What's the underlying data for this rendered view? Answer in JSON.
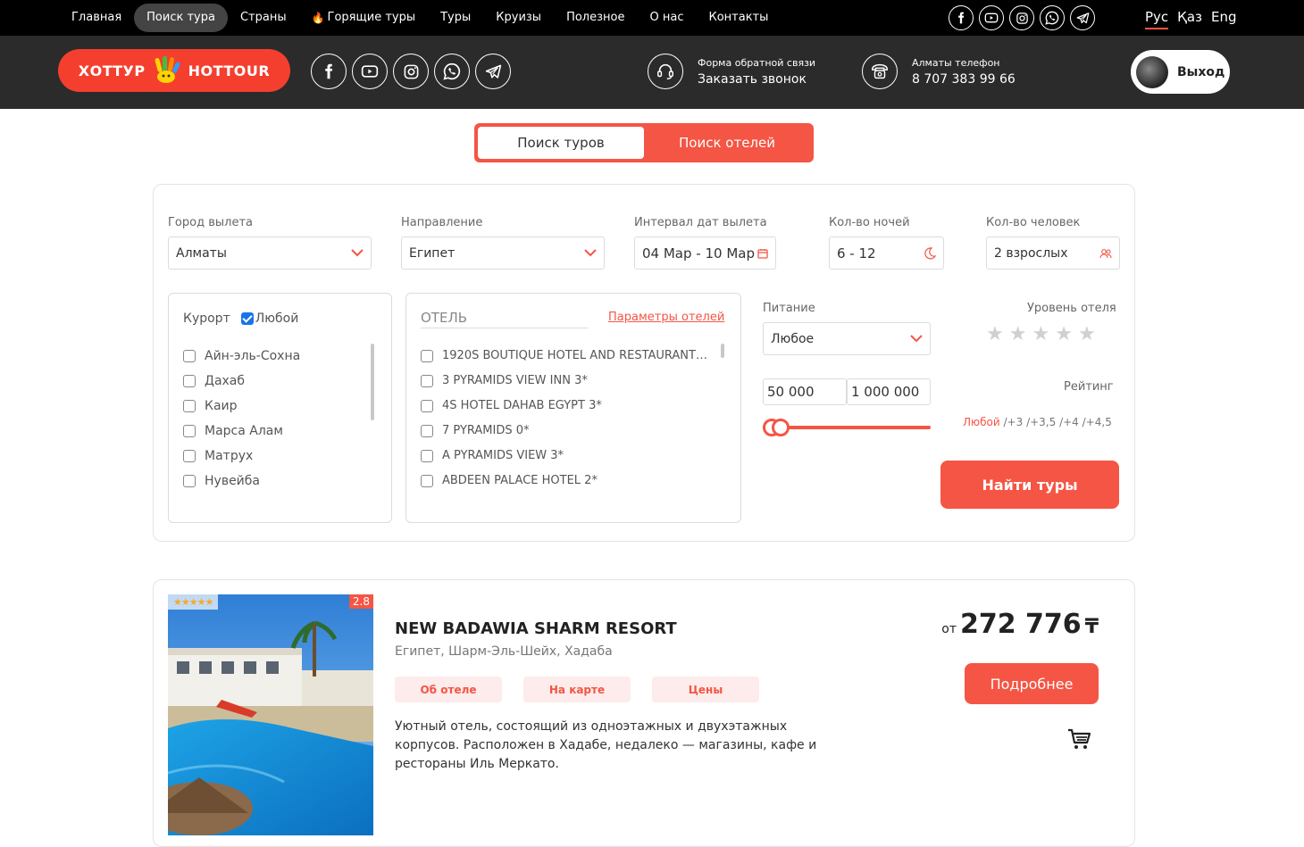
{
  "topnav": {
    "items": [
      {
        "label": "Главная",
        "active": false
      },
      {
        "label": "Поиск тура",
        "active": true
      },
      {
        "label": "Страны",
        "active": false
      },
      {
        "label": "Горящие туры",
        "active": false,
        "icon": "fire-icon"
      },
      {
        "label": "Туры",
        "active": false
      },
      {
        "label": "Круизы",
        "active": false
      },
      {
        "label": "Полезное",
        "active": false
      },
      {
        "label": "О нас",
        "active": false
      },
      {
        "label": "Контакты",
        "active": false
      }
    ],
    "languages": [
      {
        "label": "Рус",
        "active": true
      },
      {
        "label": "Қаз",
        "active": false
      },
      {
        "label": "Eng",
        "active": false
      }
    ]
  },
  "social_icons": [
    "facebook-icon",
    "youtube-icon",
    "instagram-icon",
    "whatsapp-icon",
    "telegram-icon"
  ],
  "header": {
    "logo_left": "ХОТТУР",
    "logo_right": "HOTTOUR",
    "callback": {
      "caption": "Форма обратной связи",
      "action": "Заказать звонок"
    },
    "phone": {
      "caption": "Алматы телефон",
      "number": "8 707 383 99 66"
    },
    "logout_label": "Выход"
  },
  "search_tabs": [
    {
      "label": "Поиск туров",
      "active": true
    },
    {
      "label": "Поиск отелей",
      "active": false
    }
  ],
  "search": {
    "departure": {
      "label": "Город вылета",
      "value": "Алматы"
    },
    "destination": {
      "label": "Направление",
      "value": "Египет"
    },
    "dates": {
      "label": "Интервал дат вылета",
      "value": "04 Мар - 10 Мар"
    },
    "nights": {
      "label": "Кол-во ночей",
      "value": "6 - 12"
    },
    "people": {
      "label": "Кол-во человек",
      "value": "2 взрослых"
    },
    "resort": {
      "label": "Курорт",
      "any_label": "Любой",
      "any_checked": true,
      "items": [
        "Айн-эль-Сохна",
        "Дахаб",
        "Каир",
        "Марса Алам",
        "Матрух",
        "Нувейба"
      ]
    },
    "hotel": {
      "placeholder": "ОТЕЛЬ",
      "params_link": "Параметры отелей",
      "items": [
        "1920S BOUTIQUE HOTEL AND RESTAURANT…",
        "3 PYRAMIDS VIEW INN 3*",
        "4S HOTEL DAHAB EGYPT 3*",
        "7 PYRAMIDS 0*",
        "A PYRAMIDS VIEW 3*",
        "ABDEEN PALACE HOTEL 2*"
      ]
    },
    "meal": {
      "label": "Питание",
      "value": "Любое"
    },
    "price": {
      "min": "50 000",
      "max": "1 000 000",
      "slider_min_fraction": 0.0,
      "slider_max_fraction": 0.05
    },
    "hotel_level": {
      "label": "Уровень отеля",
      "stars": 5,
      "selected": 0
    },
    "rating": {
      "label": "Рейтинг",
      "options": [
        "Любой",
        "/+3",
        "/+3,5",
        "/+4",
        "/+4,5"
      ],
      "selected": "Любой"
    },
    "submit_label": "Найти туры"
  },
  "result": {
    "stars": 5,
    "score": "2.8",
    "title": "NEW BADAWIA SHARM RESORT",
    "location": "Египет, Шарм-Эль-Шейх, Хадаба",
    "chips": [
      "Об отеле",
      "На карте",
      "Цены"
    ],
    "description": "Уютный отель, состоящий из одноэтажных и двухэтажных корпусов. Расположен в Хадабе, недалеко — магазины, кафе и рестораны Иль Меркато.",
    "price_prefix": "от",
    "price": "272 776",
    "currency": "₸",
    "details_label": "Подробнее"
  },
  "colors": {
    "accent": "#f45544",
    "topbar": "#000000",
    "header": "#2b2b2b",
    "checkbox": "#1a73e8"
  }
}
